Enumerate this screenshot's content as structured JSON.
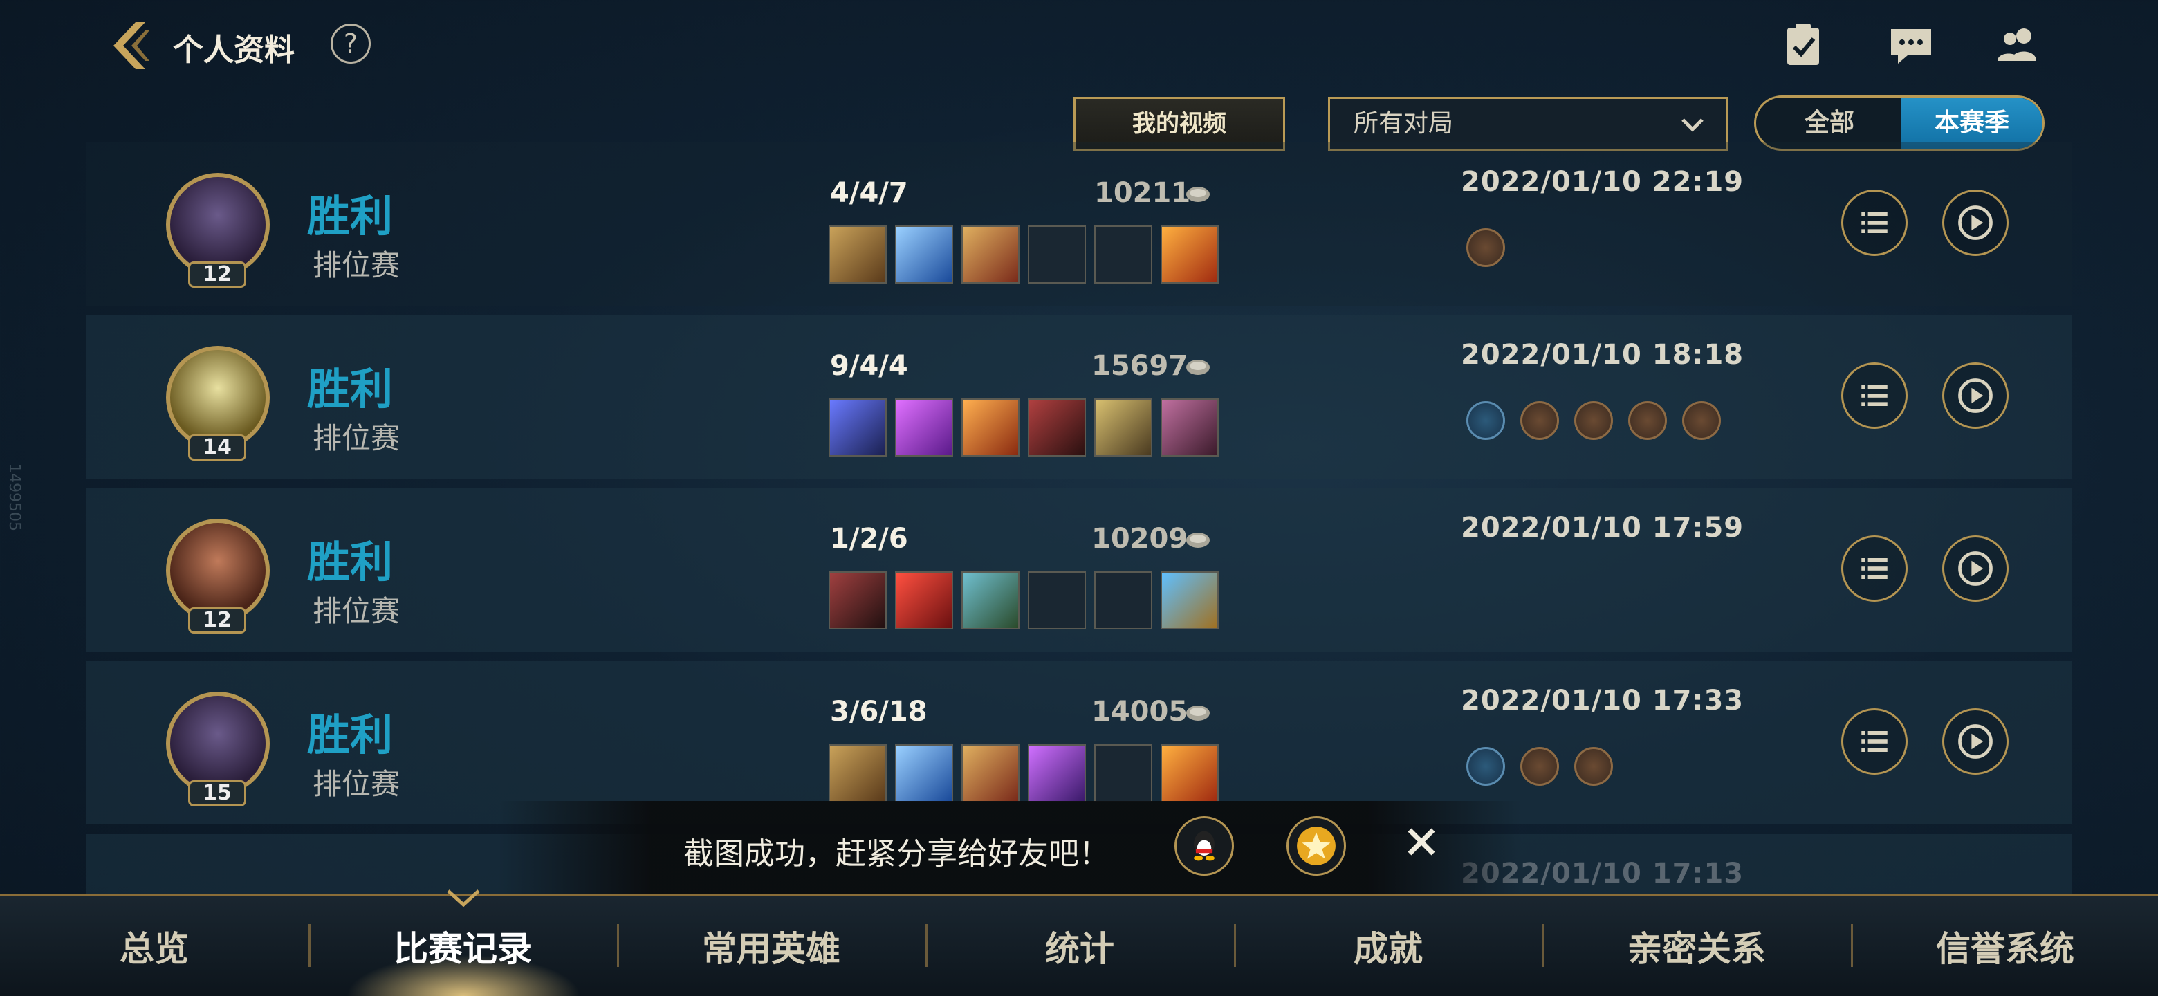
{
  "header": {
    "title": "个人资料",
    "help": "?"
  },
  "filters": {
    "video_button": "我的视频",
    "dropdown_value": "所有对局",
    "toggle": {
      "all": "全部",
      "season": "本赛季",
      "active": "season"
    }
  },
  "matches": [
    {
      "result": "胜利",
      "mode": "排位赛",
      "level": "12",
      "kda": "4/4/7",
      "gold": "10211",
      "date": "2022/01/10 22:19"
    },
    {
      "result": "胜利",
      "mode": "排位赛",
      "level": "14",
      "kda": "9/4/4",
      "gold": "15697",
      "date": "2022/01/10 18:18"
    },
    {
      "result": "胜利",
      "mode": "排位赛",
      "level": "12",
      "kda": "1/2/6",
      "gold": "10209",
      "date": "2022/01/10 17:59"
    },
    {
      "result": "胜利",
      "mode": "排位赛",
      "level": "15",
      "kda": "3/6/18",
      "gold": "14005",
      "date": "2022/01/10 17:33"
    },
    {
      "date": "2022/01/10 17:13"
    }
  ],
  "toast": {
    "text": "截图成功，赶紧分享给好友吧！"
  },
  "tabs": [
    "总览",
    "比赛记录",
    "常用英雄",
    "统计",
    "成就",
    "亲密关系",
    "信誉系统"
  ],
  "active_tab": "比赛记录",
  "side_watermark": "1499505",
  "colors": {
    "win": "#1fa0c5",
    "gold_border": "#b49552",
    "active_toggle": "#1f86bb"
  }
}
